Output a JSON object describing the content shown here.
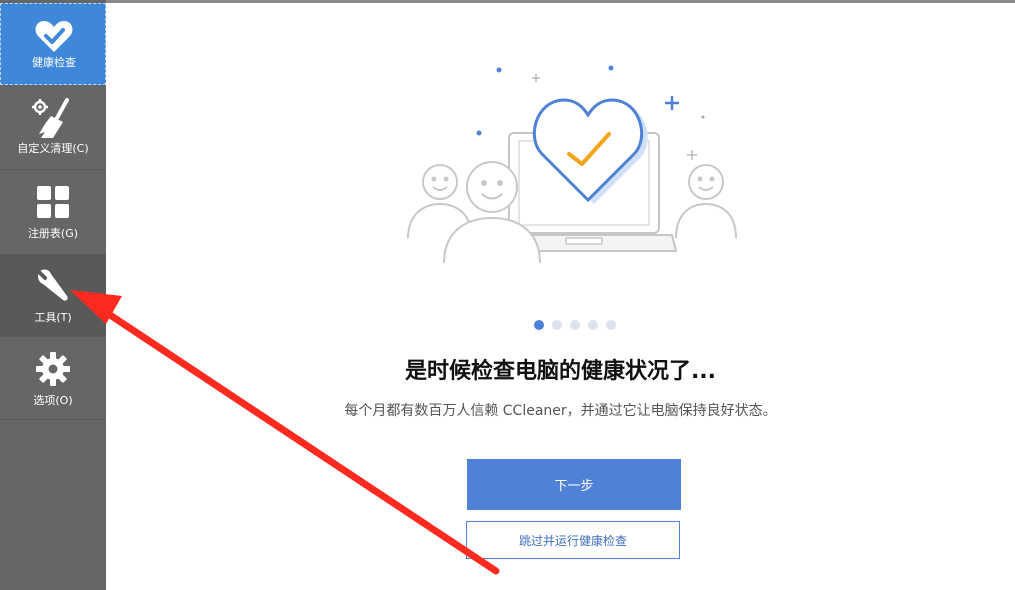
{
  "sidebar": {
    "items": [
      {
        "label": "健康检查",
        "icon": "heart-check-icon",
        "state": "active"
      },
      {
        "label": "自定义清理(C)",
        "icon": "broom-icon",
        "state": "normal"
      },
      {
        "label": "注册表(G)",
        "icon": "grid-icon",
        "state": "normal"
      },
      {
        "label": "工具(T)",
        "icon": "wrench-icon",
        "state": "hover"
      },
      {
        "label": "选项(O)",
        "icon": "gear-icon",
        "state": "normal"
      }
    ]
  },
  "main": {
    "pager": {
      "total": 5,
      "current": 1
    },
    "headline": "是时候检查电脑的健康状况了...",
    "subline": "每个月都有数百万人信赖 CCleaner，并通过它让电脑保持良好状态。",
    "next_button": "下一步",
    "skip_button": "跳过并运行健康检查"
  },
  "colors": {
    "sidebar_bg": "#666666",
    "active_bg": "#3f87d9",
    "accent_blue": "#4f81d6",
    "check_orange": "#f2a51a",
    "annotation_red": "#ff2a1f"
  }
}
